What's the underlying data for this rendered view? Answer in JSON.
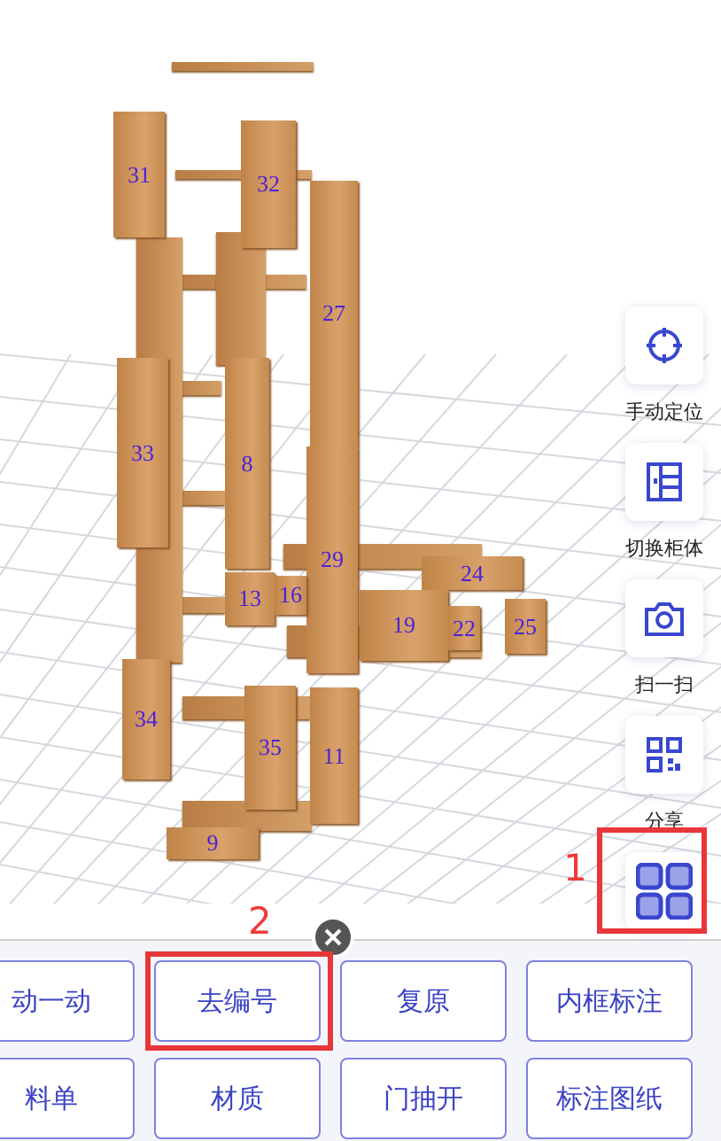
{
  "scene": {
    "panels": [
      {
        "label": "31"
      },
      {
        "label": "32"
      },
      {
        "label": "27"
      },
      {
        "label": "29"
      },
      {
        "label": "33"
      },
      {
        "label": "8"
      },
      {
        "label": "13"
      },
      {
        "label": "16"
      },
      {
        "label": "24"
      },
      {
        "label": "19"
      },
      {
        "label": "22"
      },
      {
        "label": "25"
      },
      {
        "label": "34"
      },
      {
        "label": "35"
      },
      {
        "label": "11"
      },
      {
        "label": "9"
      }
    ]
  },
  "side_tools": [
    {
      "kind": "crosshair",
      "label": "手动定位"
    },
    {
      "kind": "cabinet",
      "label": "切换柜体"
    },
    {
      "kind": "camera",
      "label": "扫一扫"
    },
    {
      "kind": "qr",
      "label": "分享"
    },
    {
      "kind": "grid",
      "callout": "1"
    }
  ],
  "actions": [
    {
      "label": "动一动"
    },
    {
      "label": "去编号",
      "callout": "2"
    },
    {
      "label": "复原"
    },
    {
      "label": "内框标注"
    },
    {
      "label": "料单"
    },
    {
      "label": "材质"
    },
    {
      "label": "门抽开"
    },
    {
      "label": "标注图纸"
    }
  ]
}
